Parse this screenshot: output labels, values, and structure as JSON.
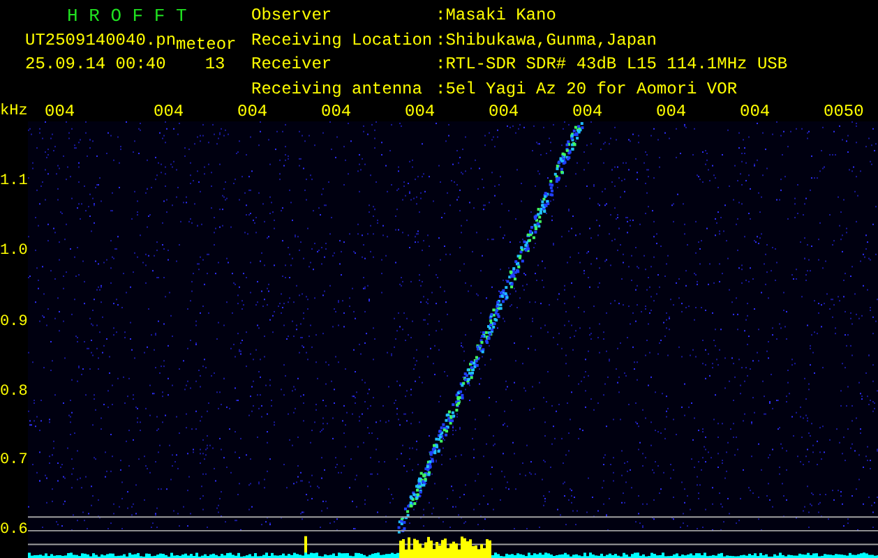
{
  "header": {
    "app_title": "H R O F F T",
    "file_name": "UT2509140040.pn",
    "mode": "meteor",
    "timestamp": "25.09.14 00:40",
    "count": "13",
    "info": [
      {
        "label": "Observer",
        "value": ":Masaki Kano"
      },
      {
        "label": "Receiving Location",
        "value": ":Shibukawa,Gunma,Japan"
      },
      {
        "label": "Receiver",
        "value": ":RTL-SDR SDR# 43dB L15 114.1MHz USB"
      },
      {
        "label": "Receiving antenna",
        "value": ":5el Yagi Az 20 for Aomori VOR"
      }
    ]
  },
  "spectrogram": {
    "unit": "kHz",
    "time_labels": [
      "004",
      "004",
      "004",
      "004",
      "004",
      "004",
      "004",
      "004",
      "004",
      "0050"
    ],
    "freq_labels": [
      "1.1",
      "1.0",
      "0.9",
      "0.8",
      "0.7",
      "0.6"
    ]
  }
}
